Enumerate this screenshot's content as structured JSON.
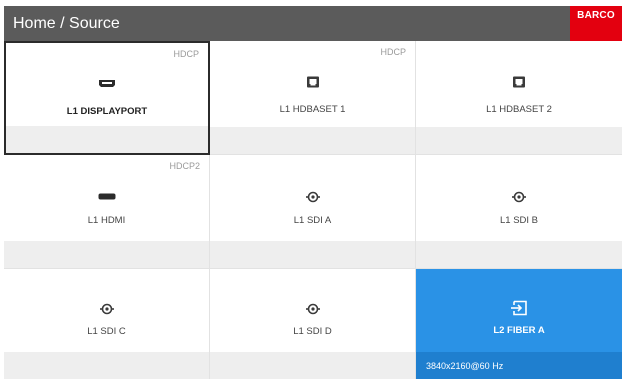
{
  "header": {
    "title": "Home / Source",
    "logo_text": "BARCO",
    "logo_color": "#e3000f"
  },
  "sources": [
    {
      "label": "L1 DISPLAYPORT",
      "badge": "HDCP",
      "icon": "displayport-icon",
      "selected": true
    },
    {
      "label": "L1 HDBASET 1",
      "badge": "HDCP",
      "icon": "hdbaset-icon"
    },
    {
      "label": "L1 HDBASET 2",
      "badge": "",
      "icon": "hdbaset-icon"
    },
    {
      "label": "L1 HDMI",
      "badge": "HDCP2",
      "icon": "hdmi-icon"
    },
    {
      "label": "L1 SDI A",
      "badge": "",
      "icon": "sdi-icon"
    },
    {
      "label": "L1 SDI B",
      "badge": "",
      "icon": "sdi-icon"
    },
    {
      "label": "L1 SDI C",
      "badge": "",
      "icon": "sdi-icon"
    },
    {
      "label": "L1 SDI D",
      "badge": "",
      "icon": "sdi-icon"
    },
    {
      "label": "L2 FIBER A",
      "badge": "",
      "icon": "input-icon",
      "active": true,
      "status": "3840x2160@60 Hz"
    }
  ],
  "colors": {
    "header_bg": "#5b5b5b",
    "active_tile": "#2a92e6",
    "active_strip": "#1f7fcf"
  }
}
